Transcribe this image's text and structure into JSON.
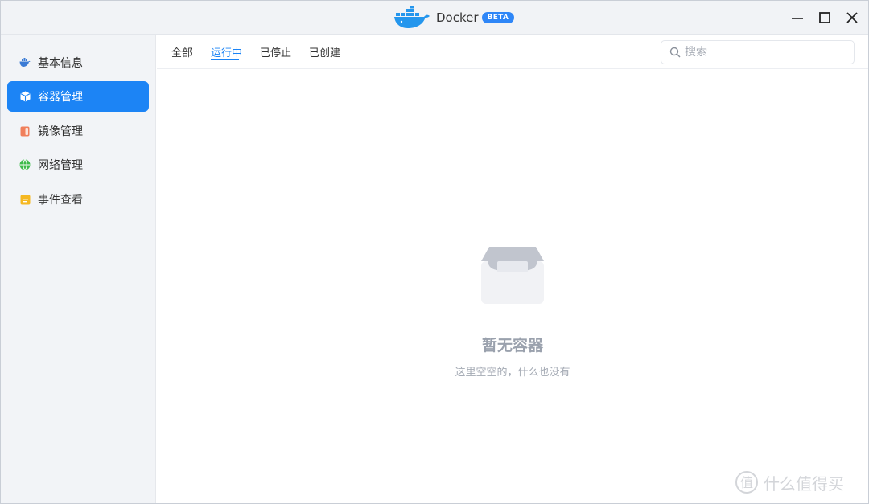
{
  "window": {
    "title": "Docker",
    "badge": "BETA",
    "controls": [
      "minimize-icon",
      "maximize-icon",
      "close-icon"
    ]
  },
  "sidebar": {
    "items": [
      {
        "label": "基本信息",
        "icon": "whale-icon",
        "color": "#3a7bd5",
        "active": false
      },
      {
        "label": "容器管理",
        "icon": "cube-icon",
        "color": "#ffffff",
        "active": true
      },
      {
        "label": "镜像管理",
        "icon": "image-icon",
        "color": "#f07f5b",
        "active": false
      },
      {
        "label": "网络管理",
        "icon": "globe-icon",
        "color": "#3dbb4a",
        "active": false
      },
      {
        "label": "事件查看",
        "icon": "event-icon",
        "color": "#f5b822",
        "active": false
      }
    ]
  },
  "tabs": [
    {
      "label": "全部",
      "active": false
    },
    {
      "label": "运行中",
      "active": true
    },
    {
      "label": "已停止",
      "active": false
    },
    {
      "label": "已创建",
      "active": false
    }
  ],
  "search": {
    "placeholder": "搜索",
    "value": ""
  },
  "empty": {
    "title": "暂无容器",
    "description": "这里空空的，什么也没有"
  },
  "watermark": {
    "text": "什么值得买"
  },
  "colors": {
    "accent": "#1c84f5",
    "sidebar_bg": "#f2f4f7",
    "titlebar_bg": "#f1f3f6"
  }
}
